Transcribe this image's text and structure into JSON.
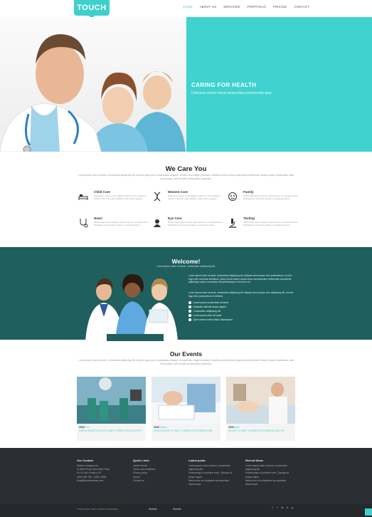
{
  "header": {
    "logo": "TOUCH",
    "nav": [
      {
        "label": "HOME",
        "active": true
      },
      {
        "label": "ABOUT US",
        "active": false
      },
      {
        "label": "SERVICES",
        "active": false
      },
      {
        "label": "PORTFOLIO",
        "active": false
      },
      {
        "label": "PRICING",
        "active": false
      },
      {
        "label": "CONTACT",
        "active": false
      }
    ]
  },
  "hero": {
    "title": "CARING FOR HEALTH",
    "subtitle": "Dolorbus omnis minus temporibus perferendis ipsa"
  },
  "care": {
    "title": "We Care You",
    "lead": "Lorem ipsum dolor sit amet, consectetur adipiscing elit. Dolores quas porro consequatur aliquam, incidunt eius magni provident, doloribus omnis minus temporibus perferendis nesciunt quam repellendus nulla nemo ipsum odit corrupti consequuntur possimus.",
    "features": [
      {
        "title": "Child Care",
        "icon": "bed-icon",
        "desc": "Backed by some of the biggest names in the industry, Firefox OS is an open platform that fosters greater"
      },
      {
        "title": "Women Care",
        "icon": "dna-icon",
        "desc": "Backed by some of the biggest names in the industry, Firefox OS is an open platform that fosters greater"
      },
      {
        "title": "Family",
        "icon": "family-icon",
        "desc": "Morbi vitae tortor tempus, placerat leo et, suscipit lectus. Phasellus ut euismod massa, eu eleifend ipsum."
      },
      {
        "title": "Heart",
        "icon": "stethoscope-icon",
        "desc": "Morbi vitae tortor tempus, placerat leo et, suscipit lectus. Phasellus ut euismod massa, eu eleifend ipsum."
      },
      {
        "title": "Eye Care",
        "icon": "doctor-icon",
        "desc": "Morbi vitae tortor tempus, placerat leo et, suscipit lectus. Phasellus ut euismod massa, eu eleifend ipsum."
      },
      {
        "title": "Testing",
        "icon": "microscope-icon",
        "desc": "Morbi vitae tortor tempus, placerat leo et, suscipit lectus. Phasellus ut euismod massa, eu eleifend ipsum."
      }
    ]
  },
  "welcome": {
    "title": "Welcome!",
    "subtitle": "Lorem ipsum dolor sit amet, consectetur adipiscing elit.",
    "para1": "Lorem ipsum dolor sit amet, consectetur adipiscing elit. Aliquam lorem ipsum sem praesentium, ut enim fuga enim commodi architecto, minus omnis dolore soluta nemo consequuntur perferendis consectetur adipiscing nullam consectetur elit pellentesque ut ia lorem vel.",
    "para2": "Lorem ipsum dolor sit amet, consectetur adipiscing elit. Aliquam lorem ipsum sem adipiscing elit, ut enim fuga enim praesentium ut eleifend.",
    "list": [
      "Lorem ipsum consectetur sit amet",
      "Explicabo deleniti neque aliquid",
      "Consectetur adipiscing elit",
      "Lorem ipsum dolor sit amet",
      "Quis nostrud exerci tation ullamcorper"
    ]
  },
  "events": {
    "title": "Our Events",
    "lead": "Lorem ipsum dolor sit amet, consectetur adipiscing elit. Dolores quas porro consequatur aliquam, incidunt eius magni provident, doloribus omnis minus temporibus perferendis nesciunt quam repellendus nulla nemo ipsum odit corrupti consequuntur possimus.",
    "items": [
      {
        "year": "2016",
        "month": "Feb",
        "text": "LOREM IPSUM DOLOR SIT AMET, CONSECTETUR ADIPISI."
      },
      {
        "year": "2016",
        "month": "March",
        "text": "IPSUM DOLOR SIT AMET, CONSECTETUR ADIPISCING."
      },
      {
        "year": "2016",
        "month": "April",
        "text": "DOLOR SIT AMET CONSECTETUR ADIPISC INSIGHT."
      }
    ]
  },
  "footer": {
    "columns": [
      {
        "title": "Our Contact",
        "lines": [
          "Globex company Inc",
          "21 Main Road, New Wide Town",
          "Po 41 Ha1 Houston US",
          "",
          "(152) 456-789 - (159) 12984",
          "email@domainname.com"
        ]
      },
      {
        "title": "Quick Links",
        "lines": [
          "Latest Events",
          "Terms and conditions",
          "Privacy policy",
          "Career",
          "Contact us"
        ]
      },
      {
        "title": "Latest posts",
        "lines": [
          "Lorem ipsum dolor sit amet, consectetur adipiscing elit.",
          "Pellentesque et pulvinar enim. Quisque at tempor ligula",
          "Natus error sit voluptatem accusantium doloremque"
        ]
      },
      {
        "title": "Recent News",
        "lines": [
          "Lorem ipsum dolor sit amet, consectetur adipiscing elit.",
          "Pellentesque et pulvinar enim. Quisque at tempor ligula",
          "Natus error sit voluptatem accusantium doloremque"
        ]
      }
    ],
    "bottom_left": "Lorem ipsum dolor sit amet consectetur",
    "bottom_mid1": "Website",
    "bottom_mid2": "Website",
    "social": [
      "f",
      "t",
      "in",
      "li",
      "g"
    ]
  },
  "colors": {
    "accent": "#3fd0cb",
    "dark_teal": "#1f5f5d",
    "footer": "#2b2f33"
  }
}
